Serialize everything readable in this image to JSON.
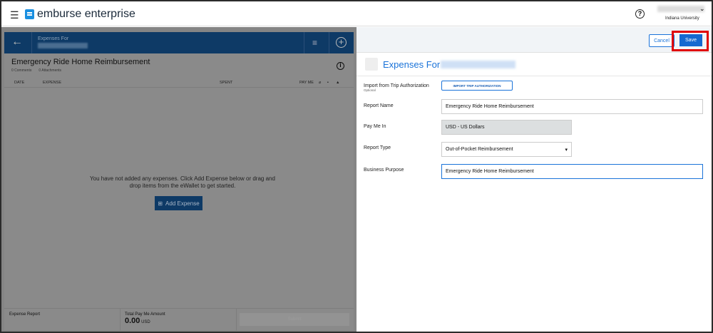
{
  "header": {
    "brand": "emburse enterprise",
    "organization": "Indiana University"
  },
  "left": {
    "header_sub": "Expenses For",
    "report_title": "Emergency Ride Home Reimbursement",
    "comments": "0 Comments",
    "attachments": "0 Attachments",
    "columns": {
      "date": "DATE",
      "expense": "EXPENSE",
      "spent": "SPENT",
      "pay_me": "PAY ME"
    },
    "empty_message": "You have not added any expenses. Click Add Expense below or drag and drop items from the eWallet to get started.",
    "add_expense": "Add Expense",
    "footer": {
      "label": "Expense Report",
      "total_label": "Total Pay Me Amount",
      "total_amount": "0.00",
      "currency": "USD",
      "submit": "Submit"
    }
  },
  "right": {
    "cancel": "Cancel",
    "save": "Save",
    "title": "Expenses For",
    "form": {
      "import_label": "Import from Trip Authorization",
      "import_optional": "Optional",
      "import_button": "IMPORT TRIP AUTHORIZATION",
      "report_name_label": "Report Name",
      "report_name": "Emergency Ride Home Reimbursement",
      "pay_me_in_label": "Pay Me In",
      "pay_me_in": "USD - US Dollars",
      "report_type_label": "Report Type",
      "report_type": "Out-of-Pocket Reimbursement",
      "business_purpose_label": "Business Purpose",
      "business_purpose": "Emergency Ride Home Reimbursement"
    }
  },
  "colors": {
    "accent": "#1a73d9",
    "highlight": "#e00000",
    "header_blue": "#0e3a66"
  }
}
